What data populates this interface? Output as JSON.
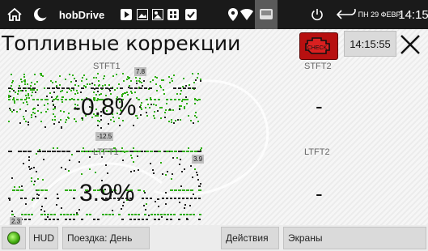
{
  "status_bar": {
    "app_name": "hobDrive",
    "date": "ПН 29 ФЕВР.",
    "time": "14:15"
  },
  "header": {
    "title": "Топливные коррекции",
    "check_label": "CHECK",
    "time": "14:15:55"
  },
  "panels": {
    "stft1": {
      "label": "STFT1",
      "value": "-0.8%",
      "max_tag": "7.8",
      "min_tag": "-12.5"
    },
    "stft2": {
      "label": "STFT2",
      "value": "-"
    },
    "ltft1": {
      "label": "LTFT1",
      "value": "3.9%",
      "max_tag": "3.9",
      "min_tag": "2.3"
    },
    "ltft2": {
      "label": "LTFT2",
      "value": "-"
    }
  },
  "bottom_bar": {
    "hud": "HUD",
    "trip": "Поездка: День",
    "actions": "Действия",
    "screens": "Экраны"
  },
  "colors": {
    "graph_green": "#2fae12",
    "check_red": "#b71010"
  }
}
